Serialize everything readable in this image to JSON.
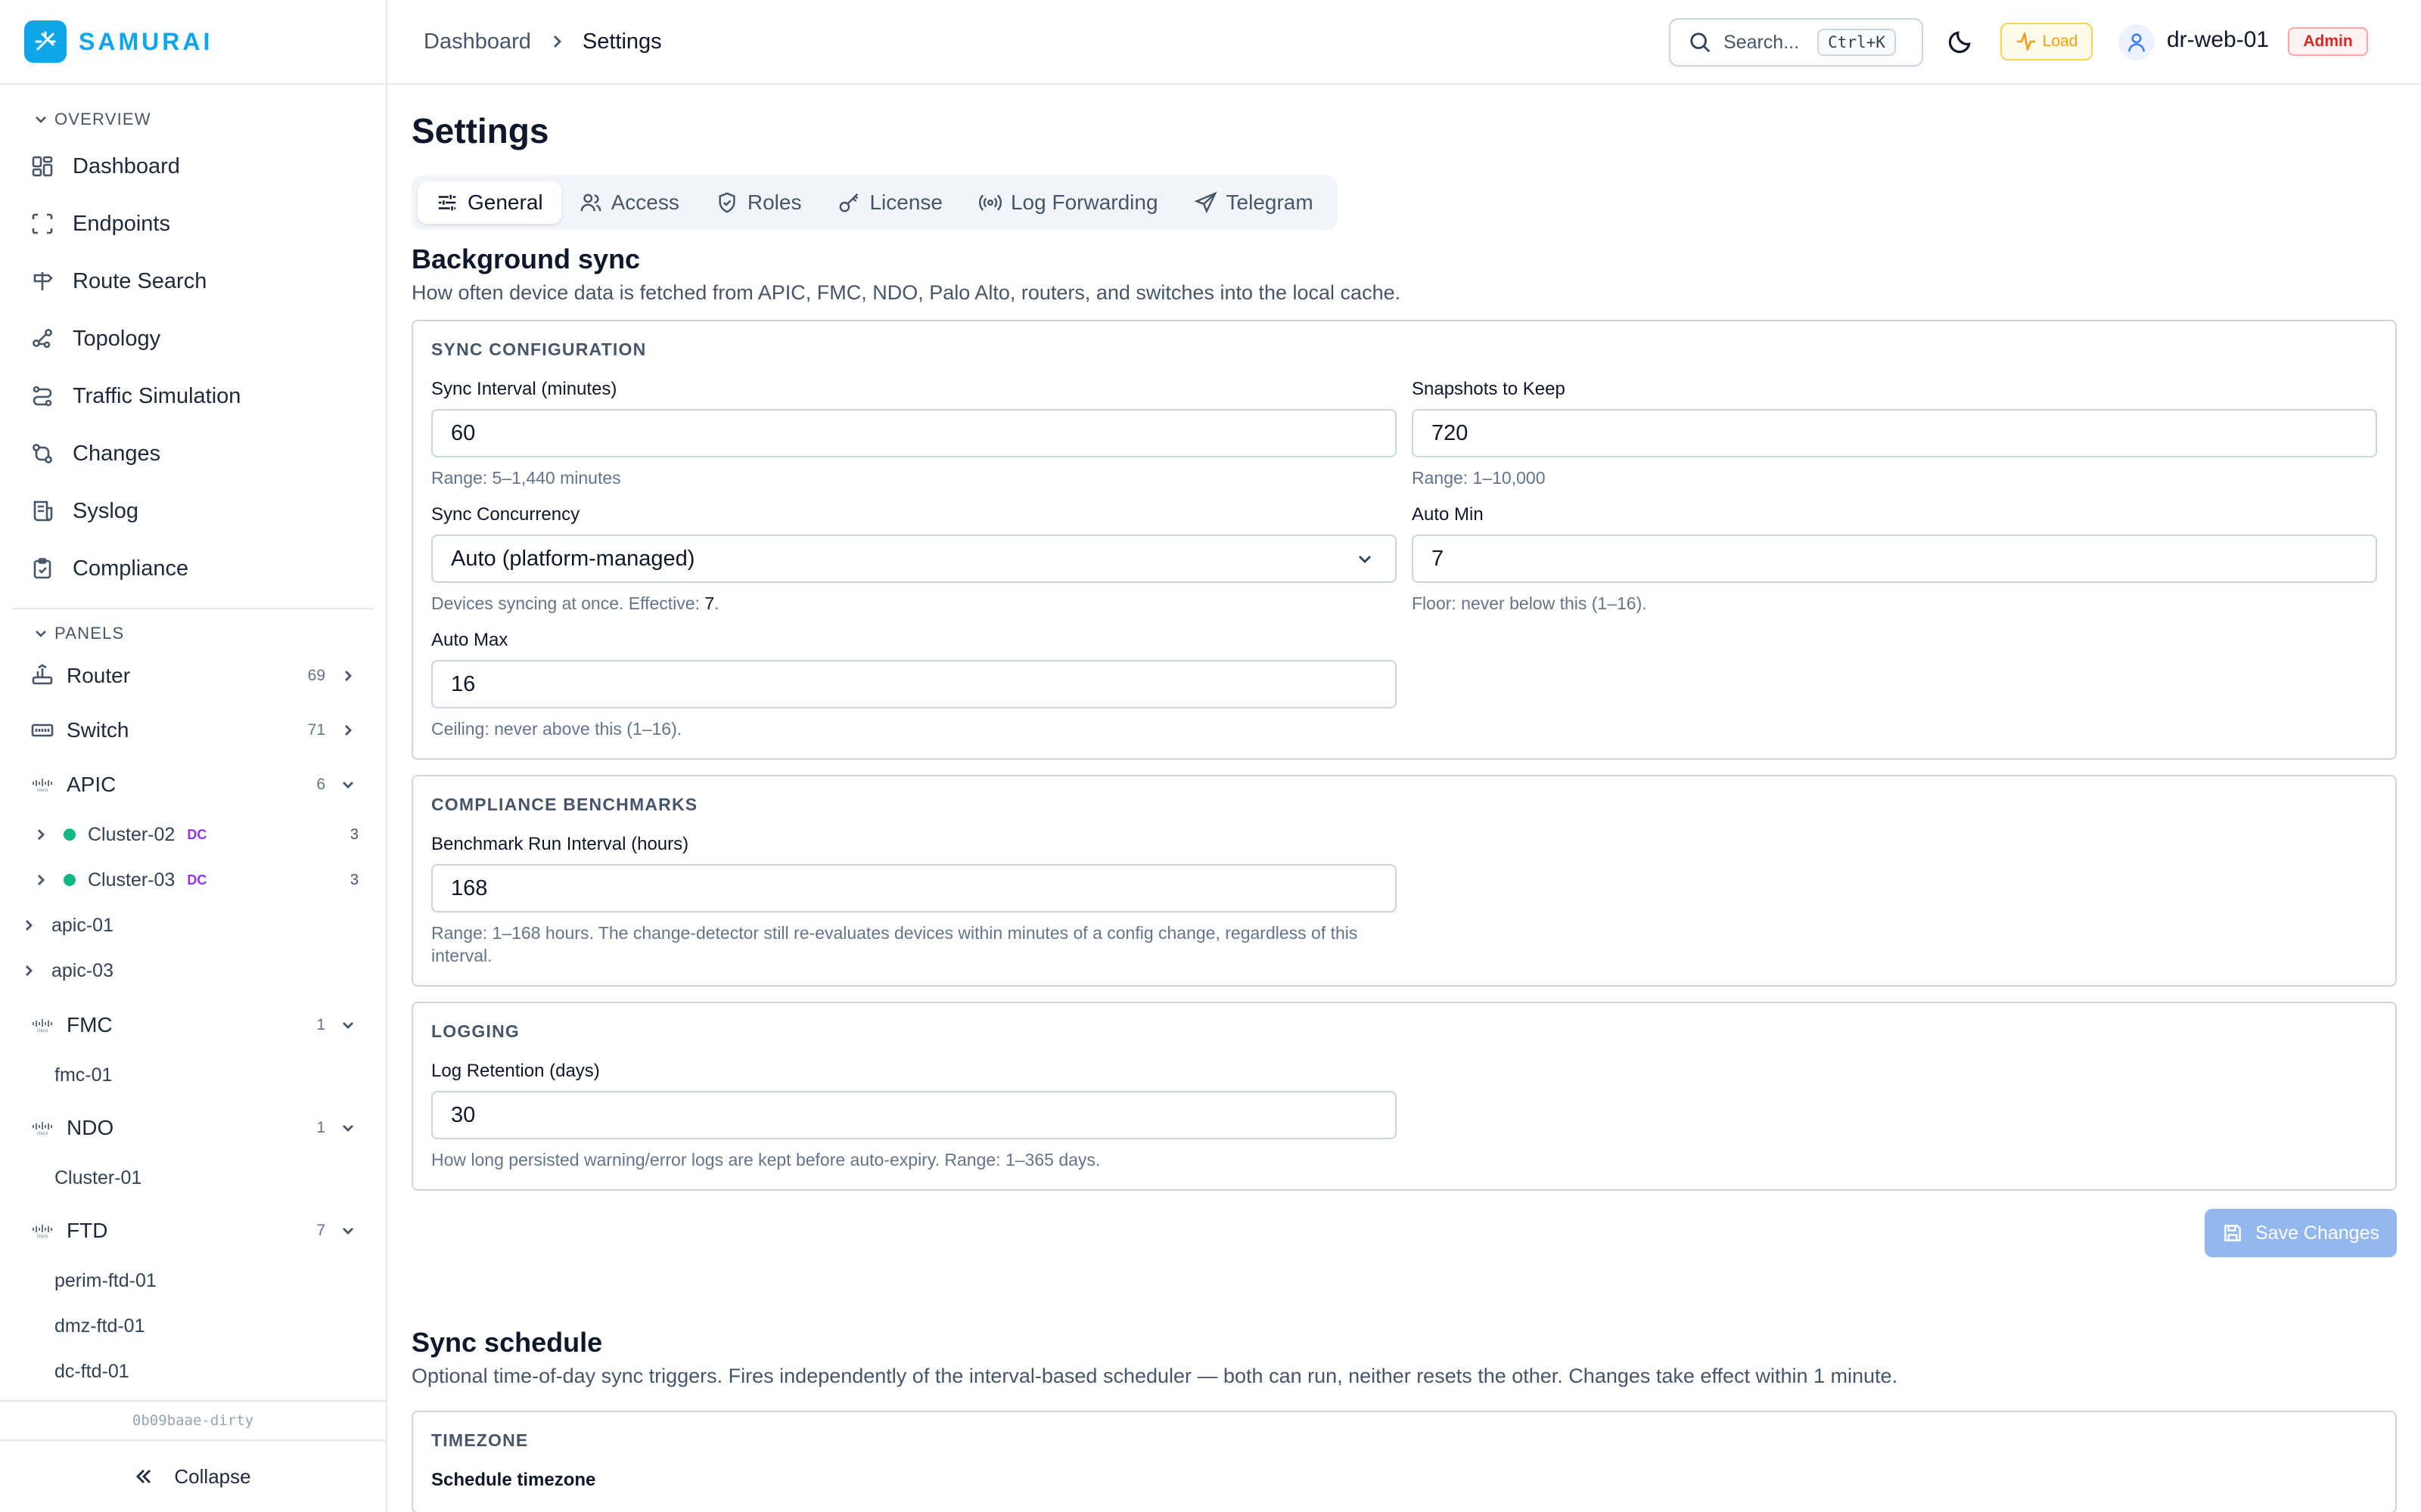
{
  "app": {
    "name": "SAMURAI",
    "version": "0b09baae-dirty",
    "collapse_label": "Collapse"
  },
  "sidebar": {
    "overview_label": "OVERVIEW",
    "nav": [
      {
        "label": "Dashboard",
        "icon": "dashboard-icon"
      },
      {
        "label": "Endpoints",
        "icon": "endpoints-icon"
      },
      {
        "label": "Route Search",
        "icon": "route-search-icon"
      },
      {
        "label": "Topology",
        "icon": "topology-icon"
      },
      {
        "label": "Traffic Simulation",
        "icon": "traffic-simulation-icon"
      },
      {
        "label": "Changes",
        "icon": "changes-icon"
      },
      {
        "label": "Syslog",
        "icon": "syslog-icon"
      },
      {
        "label": "Compliance",
        "icon": "compliance-icon"
      }
    ],
    "panels_label": "PANELS",
    "panels": {
      "router": {
        "label": "Router",
        "count": "69"
      },
      "switch": {
        "label": "Switch",
        "count": "71"
      },
      "apic": {
        "label": "APIC",
        "count": "6",
        "logo": "cisco",
        "clusters": [
          {
            "label": "Cluster-02",
            "tag": "DC",
            "count": "3"
          },
          {
            "label": "Cluster-03",
            "tag": "DC",
            "count": "3"
          }
        ],
        "devices": [
          "apic-01",
          "apic-03"
        ]
      },
      "fmc": {
        "label": "FMC",
        "count": "1",
        "logo": "cisco",
        "devices": [
          "fmc-01"
        ]
      },
      "ndo": {
        "label": "NDO",
        "count": "1",
        "logo": "cisco",
        "devices": [
          "Cluster-01"
        ]
      },
      "ftd": {
        "label": "FTD",
        "count": "7",
        "logo": "cisco",
        "devices": [
          "perim-ftd-01",
          "dmz-ftd-01",
          "dc-ftd-01"
        ]
      }
    }
  },
  "header": {
    "breadcrumb": [
      "Dashboard",
      "Settings"
    ],
    "search_placeholder": "Search...",
    "search_shortcut": "Ctrl+K",
    "load_label": "Load",
    "username": "dr-web-01",
    "role_badge": "Admin"
  },
  "page": {
    "title": "Settings",
    "tabs": [
      {
        "label": "General",
        "active": true
      },
      {
        "label": "Access"
      },
      {
        "label": "Roles"
      },
      {
        "label": "License"
      },
      {
        "label": "Log Forwarding"
      },
      {
        "label": "Telegram"
      }
    ]
  },
  "background_sync": {
    "title": "Background sync",
    "description": "How often device data is fetched from APIC, FMC, NDO, Palo Alto, routers, and switches into the local cache.",
    "sync_config": {
      "title": "SYNC CONFIGURATION",
      "interval": {
        "label": "Sync Interval (minutes)",
        "value": "60",
        "hint": "Range: 5–1,440 minutes"
      },
      "snapshots": {
        "label": "Snapshots to Keep",
        "value": "720",
        "hint": "Range: 1–10,000"
      },
      "concurrency": {
        "label": "Sync Concurrency",
        "value": "Auto (platform-managed)",
        "hint_prefix": "Devices syncing at once. Effective: ",
        "effective": "7",
        "hint_suffix": "."
      },
      "auto_min": {
        "label": "Auto Min",
        "value": "7",
        "hint": "Floor: never below this (1–16)."
      },
      "auto_max": {
        "label": "Auto Max",
        "value": "16",
        "hint": "Ceiling: never above this (1–16)."
      }
    },
    "compliance": {
      "title": "COMPLIANCE BENCHMARKS",
      "interval": {
        "label": "Benchmark Run Interval (hours)",
        "value": "168",
        "hint": "Range: 1–168 hours. The change-detector still re-evaluates devices within minutes of a config change, regardless of this interval."
      }
    },
    "logging": {
      "title": "LOGGING",
      "retention": {
        "label": "Log Retention (days)",
        "value": "30",
        "hint": "How long persisted warning/error logs are kept before auto-expiry. Range: 1–365 days."
      }
    },
    "save_label": "Save Changes"
  },
  "sync_schedule": {
    "title": "Sync schedule",
    "description": "Optional time-of-day sync triggers. Fires independently of the interval-based scheduler — both can run, neither resets the other. Changes take effect within 1 minute.",
    "timezone_card_title": "TIMEZONE",
    "timezone_label": "Schedule timezone"
  },
  "colors": {
    "brand": "#0ea5e9",
    "admin": "#dc2626",
    "load": "#f59e0b",
    "online": "#10b981",
    "dc_tag": "#9333ea",
    "save_disabled": "#93b8ee"
  }
}
